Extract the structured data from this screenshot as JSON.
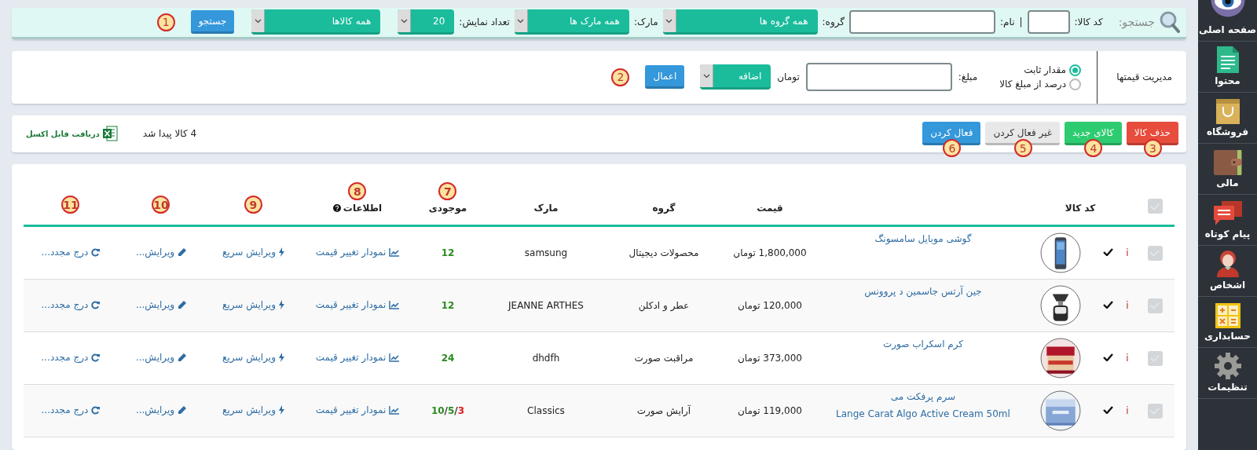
{
  "sidebar": {
    "items": [
      {
        "label": "صفحه اصلی",
        "kind": "eye"
      },
      {
        "label": "محتوا",
        "kind": "document"
      },
      {
        "label": "فروشگاه",
        "kind": "bag"
      },
      {
        "label": "مالی",
        "kind": "wallet"
      },
      {
        "label": "پیام کوتاه",
        "kind": "chat"
      },
      {
        "label": "اشخاص",
        "kind": "person"
      },
      {
        "label": "حسابداری",
        "kind": "calculator"
      },
      {
        "label": "تنظیمات",
        "kind": "gear"
      }
    ]
  },
  "search": {
    "title": "جستجو:",
    "code_label": "کد کالا:",
    "separator": "|",
    "name_label": "نام:",
    "group_label": "گروه:",
    "group_value": "همه گروه ها",
    "brand_label": "مارک:",
    "brand_value": "همه مارک ها",
    "count_label": "تعداد نمایش:",
    "count_value": "20",
    "status_value": "همه کالاها",
    "button": "جستجو",
    "callout": "1"
  },
  "price": {
    "title": "مدیریت قیمتها",
    "modes": [
      {
        "label": "مقدار ثابت",
        "selected": true
      },
      {
        "label": "درصد از مبلغ کالا",
        "selected": false
      }
    ],
    "amount_label": "مبلغ:",
    "unit": "تومان",
    "operation": "اضافه",
    "button": "اعمال",
    "callout": "2"
  },
  "toolbar": {
    "buttons": [
      {
        "label": "حذف کالا",
        "kind": "danger",
        "callout": "3"
      },
      {
        "label": "کالای جدید",
        "kind": "success",
        "callout": "4"
      },
      {
        "label": "غیر فعال کردن",
        "kind": "default",
        "callout": "5"
      },
      {
        "label": "فعال کردن",
        "kind": "primary",
        "callout": "6"
      }
    ],
    "found": "4 کالا پیدا شد",
    "excel": "دریافت فایل اکسل"
  },
  "table": {
    "select_all_checked": false,
    "columns": [
      {
        "label": "کد کالا"
      },
      {
        "label": "قیمت"
      },
      {
        "label": "گروه"
      },
      {
        "label": "مارک"
      },
      {
        "label": "موجودی",
        "callout": "7"
      },
      {
        "label": "اطلاعات",
        "callout": "8"
      },
      {
        "callout": "9"
      },
      {
        "callout": "10"
      },
      {
        "callout": "11"
      }
    ],
    "rows": [
      {
        "checked": false,
        "info": "i",
        "active": true,
        "name": "گوشی موبایل سامسونگ",
        "price": "1,800,000 تومان",
        "group": "محصولات دیجیتال",
        "brand": "samsung",
        "stock": [
          {
            "text": "12",
            "color": "#2a8a1e"
          }
        ],
        "chart": "نمودار تغییر قیمت",
        "quick_edit": "ویرایش سریع",
        "edit": "ویرایش...",
        "reinsert": "درج مجدد..."
      },
      {
        "checked": false,
        "info": "i",
        "active": true,
        "name": "جین آرتس جاسمین د پروونس",
        "price": "120,000 تومان",
        "group": "عطر و ادکلن",
        "brand": "JEANNE ARTHES",
        "stock": [
          {
            "text": "12",
            "color": "#2a8a1e"
          }
        ],
        "chart": "نمودار تغییر قیمت",
        "quick_edit": "ویرایش سریع",
        "edit": "ویرایش...",
        "reinsert": "درج مجدد..."
      },
      {
        "checked": false,
        "info": "i",
        "active": true,
        "name": "کرم اسکراب صورت",
        "price": "373,000 تومان",
        "group": "مراقبت صورت",
        "brand": "dhdfh",
        "stock": [
          {
            "text": "24",
            "color": "#2a8a1e"
          }
        ],
        "chart": "نمودار تغییر قیمت",
        "quick_edit": "ویرایش سریع",
        "edit": "ویرایش...",
        "reinsert": "درج مجدد..."
      },
      {
        "checked": false,
        "info": "i",
        "active": true,
        "name": "سرم پرفکت می",
        "subtitle": "Lange Carat Algo Active Cream 50ml",
        "price": "119,000 تومان",
        "group": "آرایش صورت",
        "brand": "Classics",
        "stock": [
          {
            "text": "3",
            "color": "#e01818"
          },
          {
            "text": "/",
            "color": "#333333"
          },
          {
            "text": "5",
            "color": "#2a8a1e"
          },
          {
            "text": "/",
            "color": "#333333"
          },
          {
            "text": "10",
            "color": "#2a8a1e"
          }
        ],
        "chart": "نمودار تغییر قیمت",
        "quick_edit": "ویرایش سریع",
        "edit": "ویرایش...",
        "reinsert": "درج مجدد..."
      }
    ]
  }
}
